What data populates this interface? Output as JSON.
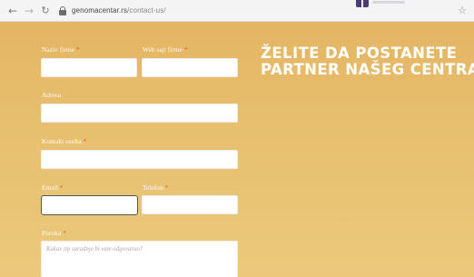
{
  "browser": {
    "back_icon": "arrow-left-icon",
    "forward_icon": "arrow-right-icon",
    "reload_icon": "reload-icon",
    "url_domain": "genomacentar.rs",
    "url_path": "/contact-us/",
    "bookmark_icon": "star-icon"
  },
  "form": {
    "company_name": {
      "label": "Naziv firme",
      "required": "*",
      "value": ""
    },
    "company_website": {
      "label": "Web sajt firme",
      "required": "*",
      "value": ""
    },
    "address": {
      "label": "Adresa",
      "value": ""
    },
    "contact_person": {
      "label": "Kontakt osoba",
      "required": "*",
      "value": ""
    },
    "email": {
      "label": "Email",
      "required": "*",
      "value": ""
    },
    "phone": {
      "label": "Telefon",
      "required": "*",
      "value": ""
    },
    "message": {
      "label": "Poruka",
      "required": "*",
      "placeholder": "Kakav tip saradnje bi vam odgovarao?"
    }
  },
  "headline": {
    "line1": "ŽELITE DA POSTANETE",
    "line2": "PARTNER NAŠEG CENTRA"
  },
  "colors": {
    "background": "#e4b563",
    "required_marker": "#e0503b",
    "headline_text": "#ffffff",
    "logo": "#4a3a78"
  }
}
